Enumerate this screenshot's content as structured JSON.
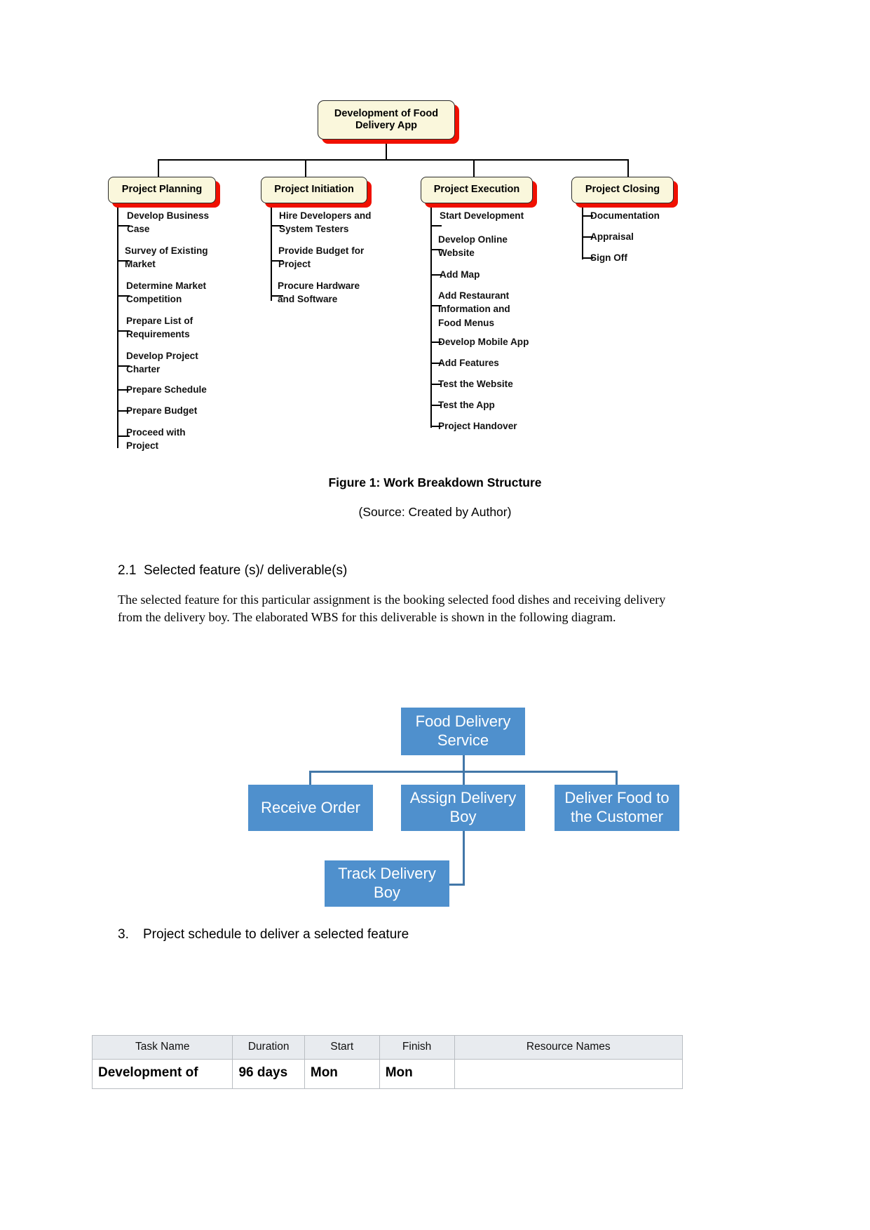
{
  "figure1": {
    "root": {
      "label": "Development of Food\nDelivery App"
    },
    "branches": [
      {
        "title": "Project Planning",
        "items": [
          "Develop Business\nCase",
          "Survey of Existing\nMarket",
          "Determine Market\nCompetition",
          "Prepare List of\nRequirements",
          "Develop Project\nCharter",
          "Prepare Schedule",
          "Prepare Budget",
          "Proceed with\nProject"
        ]
      },
      {
        "title": "Project Initiation",
        "items": [
          "Hire Developers and\nSystem Testers",
          "Provide Budget for\nProject",
          "Procure Hardware\nand Software"
        ]
      },
      {
        "title": "Project Execution",
        "items": [
          "Start Development",
          "Develop Online\nWebsite",
          "Add Map",
          "Add Restaurant\nInformation and\nFood Menus",
          "Develop Mobile App",
          "Add Features",
          "Test the Website",
          "Test the App",
          "Project Handover"
        ]
      },
      {
        "title": "Project Closing",
        "items": [
          "Documentation",
          "Appraisal",
          "Sign Off"
        ]
      }
    ],
    "caption": "Figure 1: Work Breakdown Structure",
    "source": "(Source: Created by Author)",
    "colors": {
      "node_fill": "#FAF7DC",
      "node_border": "#2b2b2b",
      "node_shadow": "#F01000",
      "connector": "#000000"
    }
  },
  "section21": {
    "heading": "2.1  Selected feature (s)/ deliverable(s)",
    "paragraph": "The selected feature for this particular assignment is the booking selected food dishes and receiving delivery from the delivery boy. The elaborated WBS for this deliverable is shown in the following diagram."
  },
  "figure2": {
    "root": "Food Delivery Service",
    "children": [
      "Receive Order",
      "Assign Delivery Boy",
      "Deliver Food to the Customer"
    ],
    "sub": "Track Delivery Boy",
    "colors": {
      "box_fill": "#4F90CD",
      "box_text": "#FFFFFF",
      "connector": "#4277A8"
    }
  },
  "section3": {
    "number": "3.",
    "heading": "Project schedule to deliver a selected feature"
  },
  "schedule_table": {
    "columns": [
      "Task Name",
      "Duration",
      "Start",
      "Finish",
      "Resource Names"
    ],
    "rows": [
      [
        "Development of",
        "96 days",
        "Mon",
        "Mon",
        ""
      ]
    ]
  }
}
